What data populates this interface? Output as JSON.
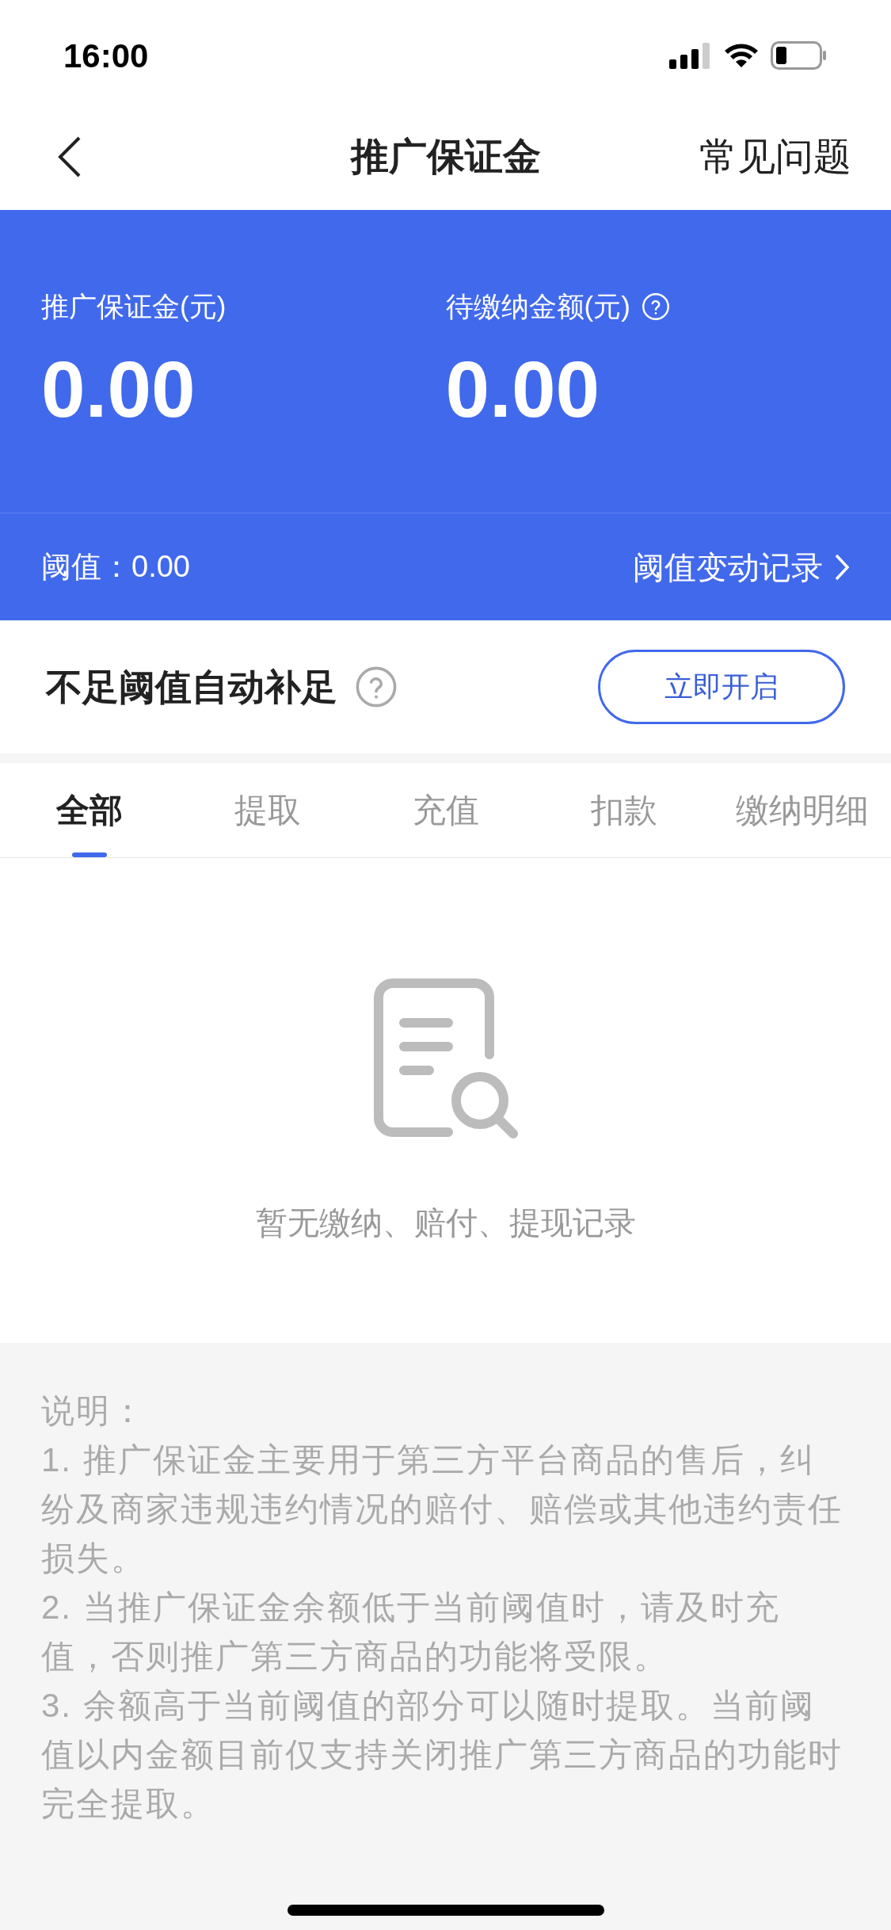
{
  "status_bar": {
    "time": "16:00"
  },
  "nav": {
    "title": "推广保证金",
    "action": "常见问题"
  },
  "summary": {
    "amounts": [
      {
        "label": "推广保证金(元)",
        "value": "0.00",
        "help": false
      },
      {
        "label": "待缴纳金额(元)",
        "value": "0.00",
        "help": true
      }
    ],
    "threshold_label": "阈值：",
    "threshold_value": "0.00",
    "history_link": "阈值变动记录"
  },
  "auto_topup": {
    "title": "不足阈值自动补足",
    "button": "立即开启"
  },
  "tabs": [
    {
      "label": "全部",
      "selected": true
    },
    {
      "label": "提取",
      "selected": false
    },
    {
      "label": "充值",
      "selected": false
    },
    {
      "label": "扣款",
      "selected": false
    },
    {
      "label": "缴纳明细",
      "selected": false
    }
  ],
  "empty_state": {
    "message": "暂无缴纳、赔付、提现记录"
  },
  "notes": {
    "heading": "说明：",
    "items": [
      "1. 推广保证金主要用于第三方平台商品的售后，纠纷及商家违规违约情况的赔付、赔偿或其他违约责任损失。",
      "2. 当推广保证金余额低于当前阈值时，请及时充值，否则推广第三方商品的功能将受限。",
      "3. 余额高于当前阈值的部分可以随时提取。当前阈值以内金额目前仅支持关闭推广第三方商品的功能时完全提取。"
    ]
  }
}
